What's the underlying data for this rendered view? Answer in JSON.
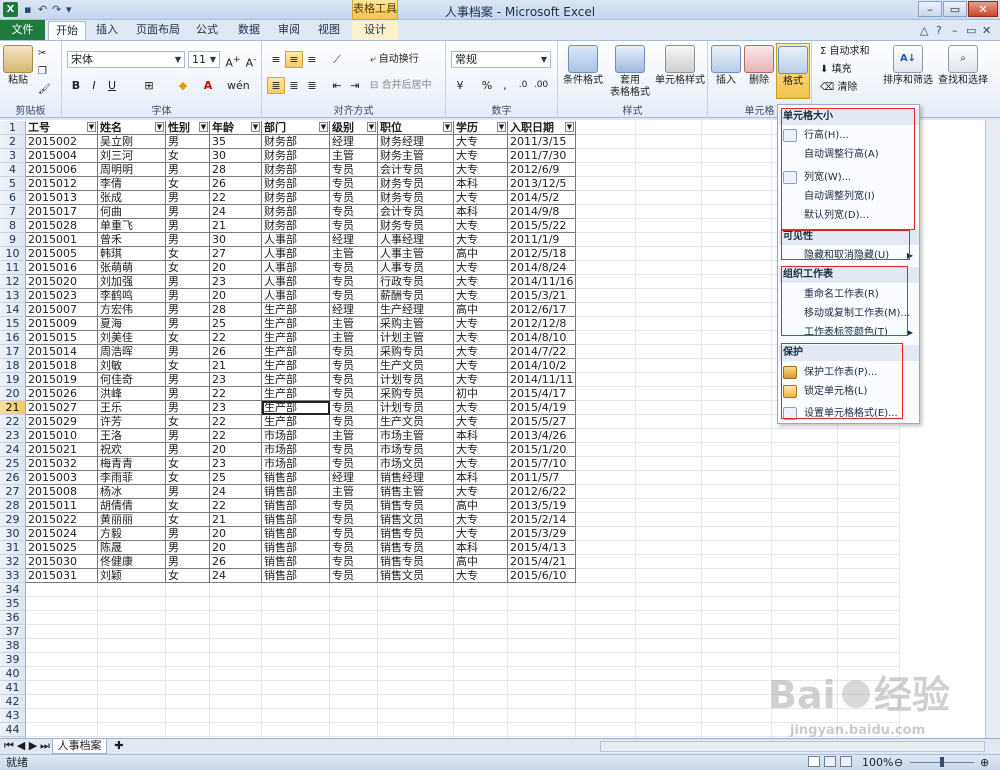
{
  "window": {
    "title": "人事档案 - Microsoft Excel",
    "context_tools": "表格工具"
  },
  "tabs": [
    "文件",
    "开始",
    "插入",
    "页面布局",
    "公式",
    "数据",
    "审阅",
    "视图",
    "设计"
  ],
  "ribbon": {
    "font_name": "宋体",
    "font_size": "11",
    "groups": [
      "剪贴板",
      "字体",
      "对齐方式",
      "数字",
      "样式",
      "单元格"
    ],
    "paste": "粘贴",
    "wrap_text": "自动换行",
    "merge_center": "合并后居中",
    "number_format": "常规",
    "cond_format": "条件格式",
    "table_format_1": "套用",
    "table_format_2": "表格格式",
    "cell_styles": "单元格样式",
    "insert": "插入",
    "delete": "删除",
    "format": "格式",
    "autosum": "Σ 自动求和",
    "fill": "填充",
    "clear": "清除",
    "sort_filter": "排序和筛选",
    "find_select": "查找和选择"
  },
  "table": {
    "headers": [
      "工号",
      "姓名",
      "性别",
      "年龄",
      "部门",
      "级别",
      "职位",
      "学历",
      "入职日期"
    ],
    "rows": [
      [
        "2015002",
        "吴立刚",
        "男",
        "35",
        "财务部",
        "经理",
        "财务经理",
        "大专",
        "2011/3/15"
      ],
      [
        "2015004",
        "刘三河",
        "女",
        "30",
        "财务部",
        "主管",
        "财务主管",
        "大专",
        "2011/7/30"
      ],
      [
        "2015006",
        "周明明",
        "男",
        "28",
        "财务部",
        "专员",
        "会计专员",
        "大专",
        "2012/6/9"
      ],
      [
        "2015012",
        "李倩",
        "女",
        "26",
        "财务部",
        "专员",
        "财务专员",
        "本科",
        "2013/12/5"
      ],
      [
        "2015013",
        "张成",
        "男",
        "22",
        "财务部",
        "专员",
        "财务专员",
        "大专",
        "2014/5/2"
      ],
      [
        "2015017",
        "何曲",
        "男",
        "24",
        "财务部",
        "专员",
        "会计专员",
        "本科",
        "2014/9/8"
      ],
      [
        "2015028",
        "单重飞",
        "男",
        "21",
        "财务部",
        "专员",
        "财务专员",
        "大专",
        "2015/5/22"
      ],
      [
        "2015001",
        "曾禾",
        "男",
        "30",
        "人事部",
        "经理",
        "人事经理",
        "大专",
        "2011/1/9"
      ],
      [
        "2015005",
        "韩琪",
        "女",
        "27",
        "人事部",
        "主管",
        "人事主管",
        "高中",
        "2012/5/18"
      ],
      [
        "2015016",
        "张萌萌",
        "女",
        "20",
        "人事部",
        "专员",
        "人事专员",
        "大专",
        "2014/8/24"
      ],
      [
        "2015020",
        "刘加强",
        "男",
        "23",
        "人事部",
        "专员",
        "行政专员",
        "大专",
        "2014/11/16"
      ],
      [
        "2015023",
        "李鹤鸣",
        "男",
        "20",
        "人事部",
        "专员",
        "薪酬专员",
        "大专",
        "2015/3/21"
      ],
      [
        "2015007",
        "方宏伟",
        "男",
        "28",
        "生产部",
        "经理",
        "生产经理",
        "高中",
        "2012/6/17"
      ],
      [
        "2015009",
        "夏海",
        "男",
        "25",
        "生产部",
        "主管",
        "采购主管",
        "大专",
        "2012/12/8"
      ],
      [
        "2015015",
        "刘美佳",
        "女",
        "22",
        "生产部",
        "主管",
        "计划主管",
        "大专",
        "2014/8/10"
      ],
      [
        "2015014",
        "周浩晖",
        "男",
        "26",
        "生产部",
        "专员",
        "采购专员",
        "大专",
        "2014/7/22"
      ],
      [
        "2015018",
        "刘敏",
        "女",
        "21",
        "生产部",
        "专员",
        "生产文员",
        "大专",
        "2014/10/2"
      ],
      [
        "2015019",
        "何佳奇",
        "男",
        "23",
        "生产部",
        "专员",
        "计划专员",
        "大专",
        "2014/11/11"
      ],
      [
        "2015026",
        "洪峰",
        "男",
        "22",
        "生产部",
        "专员",
        "采购专员",
        "初中",
        "2015/4/17"
      ],
      [
        "2015027",
        "王乐",
        "男",
        "23",
        "生产部",
        "专员",
        "计划专员",
        "大专",
        "2015/4/19"
      ],
      [
        "2015029",
        "许芳",
        "女",
        "22",
        "生产部",
        "专员",
        "生产文员",
        "大专",
        "2015/5/27"
      ],
      [
        "2015010",
        "王洛",
        "男",
        "22",
        "市场部",
        "主管",
        "市场主管",
        "本科",
        "2013/4/26"
      ],
      [
        "2015021",
        "祝欢",
        "男",
        "20",
        "市场部",
        "专员",
        "市场专员",
        "大专",
        "2015/1/20"
      ],
      [
        "2015032",
        "梅青青",
        "女",
        "23",
        "市场部",
        "专员",
        "市场文员",
        "大专",
        "2015/7/10"
      ],
      [
        "2015003",
        "李雨菲",
        "女",
        "25",
        "销售部",
        "经理",
        "销售经理",
        "本科",
        "2011/5/7"
      ],
      [
        "2015008",
        "杨冰",
        "男",
        "24",
        "销售部",
        "主管",
        "销售主管",
        "大专",
        "2012/6/22"
      ],
      [
        "2015011",
        "胡倩倩",
        "女",
        "22",
        "销售部",
        "专员",
        "销售专员",
        "高中",
        "2013/5/19"
      ],
      [
        "2015022",
        "黄丽丽",
        "女",
        "21",
        "销售部",
        "专员",
        "销售文员",
        "大专",
        "2015/2/14"
      ],
      [
        "2015024",
        "方毅",
        "男",
        "20",
        "销售部",
        "专员",
        "销售专员",
        "大专",
        "2015/3/29"
      ],
      [
        "2015025",
        "陈晟",
        "男",
        "20",
        "销售部",
        "专员",
        "销售专员",
        "本科",
        "2015/4/13"
      ],
      [
        "2015030",
        "佟健康",
        "男",
        "26",
        "销售部",
        "专员",
        "销售专员",
        "高中",
        "2015/4/21"
      ],
      [
        "2015031",
        "刘颖",
        "女",
        "24",
        "销售部",
        "专员",
        "销售文员",
        "大专",
        "2015/6/10"
      ]
    ]
  },
  "row_numbers": [
    "1",
    "2",
    "3",
    "4",
    "5",
    "6",
    "7",
    "8",
    "9",
    "10",
    "11",
    "12",
    "13",
    "14",
    "15",
    "16",
    "17",
    "18",
    "19",
    "20",
    "21",
    "22",
    "23",
    "24",
    "25",
    "26",
    "27",
    "28",
    "29",
    "30",
    "31",
    "32",
    "33",
    "34",
    "35",
    "36",
    "37",
    "38",
    "39",
    "40",
    "41",
    "42",
    "43",
    "44",
    "45",
    "46"
  ],
  "format_menu": {
    "sec_size": "单元格大小",
    "row_height": "行高(H)...",
    "autofit_row": "自动调整行高(A)",
    "col_width": "列宽(W)...",
    "autofit_col": "自动调整列宽(I)",
    "default_width": "默认列宽(D)...",
    "sec_visibility": "可见性",
    "hide_unhide": "隐藏和取消隐藏(U)",
    "sec_organize": "组织工作表",
    "rename": "重命名工作表(R)",
    "move_copy": "移动或复制工作表(M)...",
    "tab_color": "工作表标签颜色(T)",
    "sec_protect": "保护",
    "protect_sheet": "保护工作表(P)...",
    "lock_cell": "锁定单元格(L)",
    "format_cells": "设置单元格格式(E)..."
  },
  "sheet_tab": "人事档案",
  "status": {
    "ready": "就绪",
    "zoom": "100%"
  },
  "colors": {
    "excel_green": "#1f7a3d",
    "highlight_red": "#e02828"
  }
}
